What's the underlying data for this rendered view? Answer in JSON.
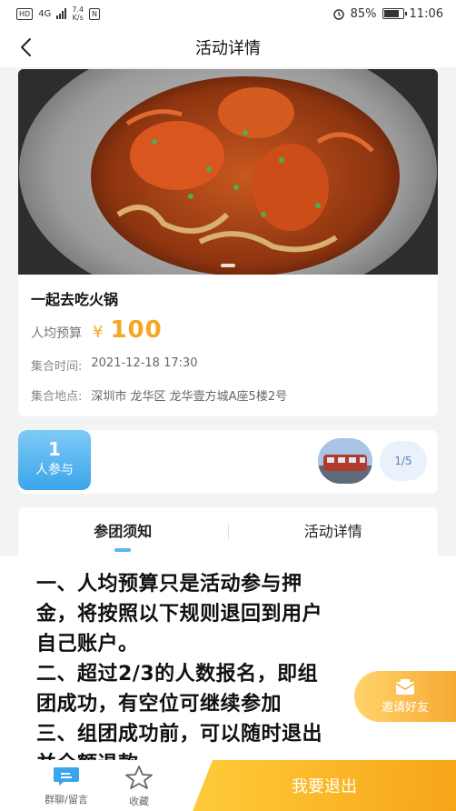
{
  "status_bar": {
    "badge": "HD",
    "network": "4G",
    "speed_value": "7.4",
    "speed_unit": "K/s",
    "nfc": "N",
    "battery": "85%",
    "battery_level": 0.85,
    "time": "11:06"
  },
  "nav": {
    "title": "活动详情"
  },
  "activity": {
    "title": "一起去吃火锅",
    "budget_label": "人均预算",
    "currency": "¥",
    "price": "100",
    "time_label": "集合时间:",
    "time_value": "2021-12-18 17:30",
    "place_label": "集合地点:",
    "place_value": "深圳市 龙华区 龙华壹方城A座5楼2号"
  },
  "participants": {
    "count": "1",
    "label": "人参与",
    "ratio": "1/5"
  },
  "tabs": [
    {
      "label": "参团须知",
      "active": true
    },
    {
      "label": "活动详情",
      "active": false
    }
  ],
  "notice_lines": [
    "一、人均预算只是活动参与押",
    "金，将按照以下规则退回到用户",
    "自己账户。",
    "二、超过2/3的人数报名，即组",
    "团成功，有空位可继续参加",
    "三、组团成功前，可以随时退出",
    "并全额退款"
  ],
  "invite": {
    "label": "邀请好友"
  },
  "bottom": {
    "chat_label": "群聊/留言",
    "fav_label": "收藏",
    "exit_label": "我要退出"
  },
  "colors": {
    "accent_blue": "#3aa5ea",
    "accent_orange": "#f5a623"
  }
}
